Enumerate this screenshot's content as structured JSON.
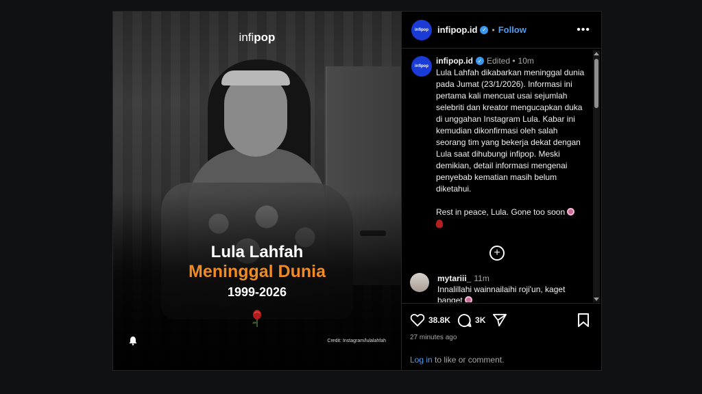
{
  "image": {
    "brand_prefix": "infi",
    "brand_suffix": "pop",
    "name": "Lula Lahfah",
    "headline": "Meninggal Dunia",
    "years": "1999-2026",
    "credit": "Credit: Instagram/lulalahfah"
  },
  "header": {
    "avatar_text": "infipop",
    "username": "infipop.id",
    "separator": "•",
    "follow": "Follow",
    "more": "•••"
  },
  "caption": {
    "avatar_text": "infipop",
    "username": "infipop.id",
    "edited": "Edited •",
    "time": "10m",
    "paragraph1": "Lula Lahfah dikabarkan meninggal dunia pada Jumat (23/1/2026). Informasi ini pertama kali mencuat usai sejumlah selebriti dan kreator mengucapkan duka di unggahan Instagram Lula. Kabar ini kemudian dikonfirmasi oleh salah seorang tim yang bekerja dekat dengan Lula saat dihubungi infipop. Meski demikian, detail informasi mengenai penyebab kematian masih belum diketahui.",
    "paragraph2": "Rest in peace, Lula. Gone too soon"
  },
  "load_more": "+",
  "comment": {
    "username": "mytariii_",
    "time": "11m",
    "text": "Innalillahi wainnailaihi roji'un, kaget banget"
  },
  "actions": {
    "likes": "38.8K",
    "comments": "3K",
    "posted_ago": "27 minutes ago"
  },
  "footer": {
    "login_link": "Log in",
    "login_text": " to like or comment."
  },
  "colors": {
    "accent": "#4a9df8",
    "headline": "#f08a24",
    "avatar_bg": "#1a3bd6"
  }
}
